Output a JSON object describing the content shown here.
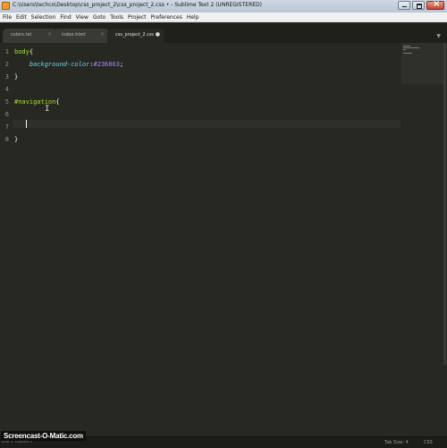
{
  "window": {
    "title": "C:\\Users\\techco\\Desktop\\css_project_2\\css_project_2.css • - Sublime Text 2 (UNREGISTERED)"
  },
  "menu": {
    "items": [
      "File",
      "Edit",
      "Selection",
      "Find",
      "View",
      "Goto",
      "Tools",
      "Project",
      "Preferences",
      "Help"
    ]
  },
  "tabs": [
    {
      "label": "colors.txt",
      "close": "×",
      "active": false
    },
    {
      "label": "index.html",
      "close": "×",
      "active": false
    },
    {
      "label": "css_project_2.css",
      "close": "●",
      "active": true
    }
  ],
  "tab_dropdown": "▼",
  "editor": {
    "line_numbers": [
      "1",
      "2",
      "3",
      "4",
      "5",
      "6",
      "7",
      "8"
    ],
    "line1": {
      "selector": "body",
      "brace": "{"
    },
    "line2": {
      "indent": "    ",
      "property": "background-color",
      "colon": ":",
      "value": "#236863",
      "semi": ";"
    },
    "line3": {
      "brace": "}"
    },
    "line5": {
      "selector": "#navigation",
      "brace": "{"
    },
    "line8": {
      "brace": "}"
    }
  },
  "statusbar": {
    "left": "Line 7, Column 5",
    "tab_size": "Tab Size: 4",
    "syntax": "CSS"
  },
  "watermark": "Screencast-O-Matic.com",
  "colors": {
    "editor_bg": "#272822",
    "selector": "#a6e22e",
    "property": "#66d9ef",
    "value": "#ae81ff",
    "line_number": "#8f908a"
  }
}
